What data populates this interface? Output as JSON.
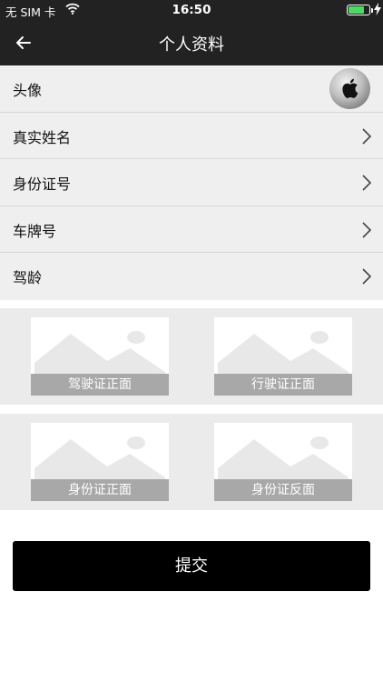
{
  "status_bar": {
    "carrier": "无 SIM 卡",
    "time": "16:50",
    "battery_level": 0.7
  },
  "nav": {
    "title": "个人资料",
    "back_icon": "arrow-left-icon"
  },
  "rows": [
    {
      "label": "头像",
      "accessory": "avatar"
    },
    {
      "label": "真实姓名",
      "accessory": "chevron-right-icon"
    },
    {
      "label": "身份证号",
      "accessory": "chevron-right-icon"
    },
    {
      "label": "车牌号",
      "accessory": "chevron-right-icon"
    },
    {
      "label": "驾龄",
      "accessory": "chevron-right-icon"
    }
  ],
  "photos": {
    "driver_license_front": "驾驶证正面",
    "vehicle_license_front": "行驶证正面",
    "id_card_front": "身份证正面",
    "id_card_back": "身份证反面"
  },
  "submit_label": "提交",
  "colors": {
    "bar_bg": "#222222",
    "row_bg": "#efefef",
    "section_bg": "#ebebeb",
    "caption_bg": "#a8a8a8",
    "submit_bg": "#000000",
    "battery": "#4cd964"
  }
}
